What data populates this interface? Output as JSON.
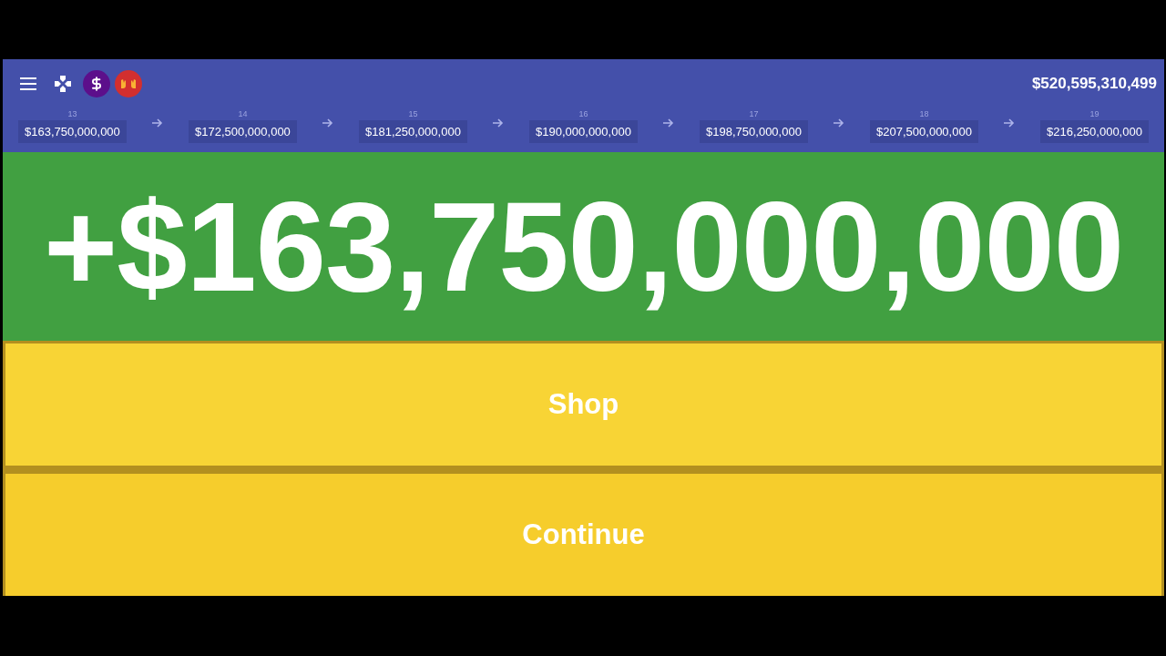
{
  "top_bar": {
    "balance": "$520,595,310,499"
  },
  "levels": [
    {
      "number": "13",
      "amount": "$163,750,000,000"
    },
    {
      "number": "14",
      "amount": "$172,500,000,000"
    },
    {
      "number": "15",
      "amount": "$181,250,000,000"
    },
    {
      "number": "16",
      "amount": "$190,000,000,000"
    },
    {
      "number": "17",
      "amount": "$198,750,000,000"
    },
    {
      "number": "18",
      "amount": "$207,500,000,000"
    },
    {
      "number": "19",
      "amount": "$216,250,000,000"
    }
  ],
  "payout": "+$163,750,000,000",
  "buttons": [
    {
      "label": "Shop"
    },
    {
      "label": "Continue"
    }
  ]
}
